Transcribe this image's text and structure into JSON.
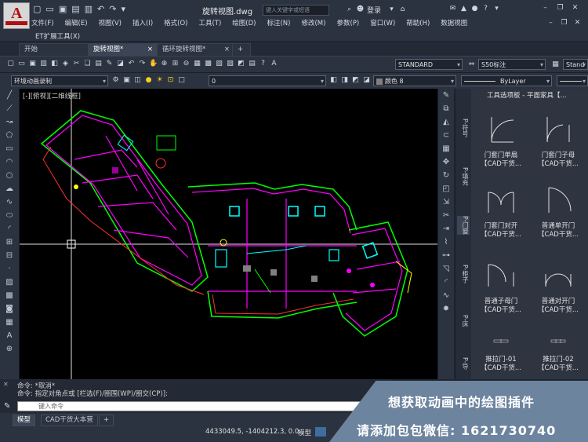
{
  "titlebar": {
    "doc_title": "旋转视图.dwg",
    "search_placeholder": "键入关键字或短语",
    "login": "登录"
  },
  "menu": {
    "items": [
      "文件(F)",
      "编辑(E)",
      "视图(V)",
      "插入(I)",
      "格式(O)",
      "工具(T)",
      "绘图(D)",
      "标注(N)",
      "修改(M)",
      "参数(P)",
      "窗口(W)",
      "帮助(H)",
      "数据视图"
    ],
    "extra": "ET扩展工具(X)"
  },
  "tabs": [
    "开始",
    "旋转视图*",
    "循环旋转视图*"
  ],
  "toolbar": {
    "text_style": "STANDARD",
    "dim_style": "S50标注",
    "table_style": "Stand",
    "layer_state": "环境动画录制",
    "current_layer": "0",
    "color": "颜色 8",
    "linetype": "ByLayer"
  },
  "viewport": {
    "label": "[-][俯视][二维线框]"
  },
  "palette": {
    "title": "工具选项板 - 平面家具【...",
    "side_tabs": [
      "P-符号",
      "P-填充",
      "P-门窗",
      "P-柜子",
      "P-床",
      "P-导"
    ],
    "items": [
      {
        "name": "门套门单扇",
        "sub": "【CAD干货..."
      },
      {
        "name": "门套门子母",
        "sub": "【CAD干货..."
      },
      {
        "name": "门套门对开",
        "sub": "【CAD干货..."
      },
      {
        "name": "普通单开门",
        "sub": "【CAD干货..."
      },
      {
        "name": "普通子母门",
        "sub": "【CAD干货..."
      },
      {
        "name": "普通对开门",
        "sub": "【CAD干货..."
      },
      {
        "name": "推拉门-01",
        "sub": "【CAD干货..."
      },
      {
        "name": "推拉门-02",
        "sub": "【CAD干货..."
      }
    ]
  },
  "command": {
    "line1": "命令: *取消*",
    "line2": "命令: 指定对角点或 [栏选(F)/圈围(WP)/圈交(CP)]:",
    "placeholder": "键入命令"
  },
  "status": {
    "tabs": [
      "模型",
      "CAD干货大本营"
    ],
    "coords": "4433049.5, -1404212.3, 0.0",
    "mode": "模型"
  },
  "promo": {
    "line1": "想获取动画中的绘图插件",
    "line2": "请添加包包微信: 1621730740"
  },
  "colors": {
    "wall": "#ff00ff",
    "green": "#00ff00",
    "cyan": "#00ffff",
    "yellow": "#ffff00",
    "red": "#ff3030"
  }
}
